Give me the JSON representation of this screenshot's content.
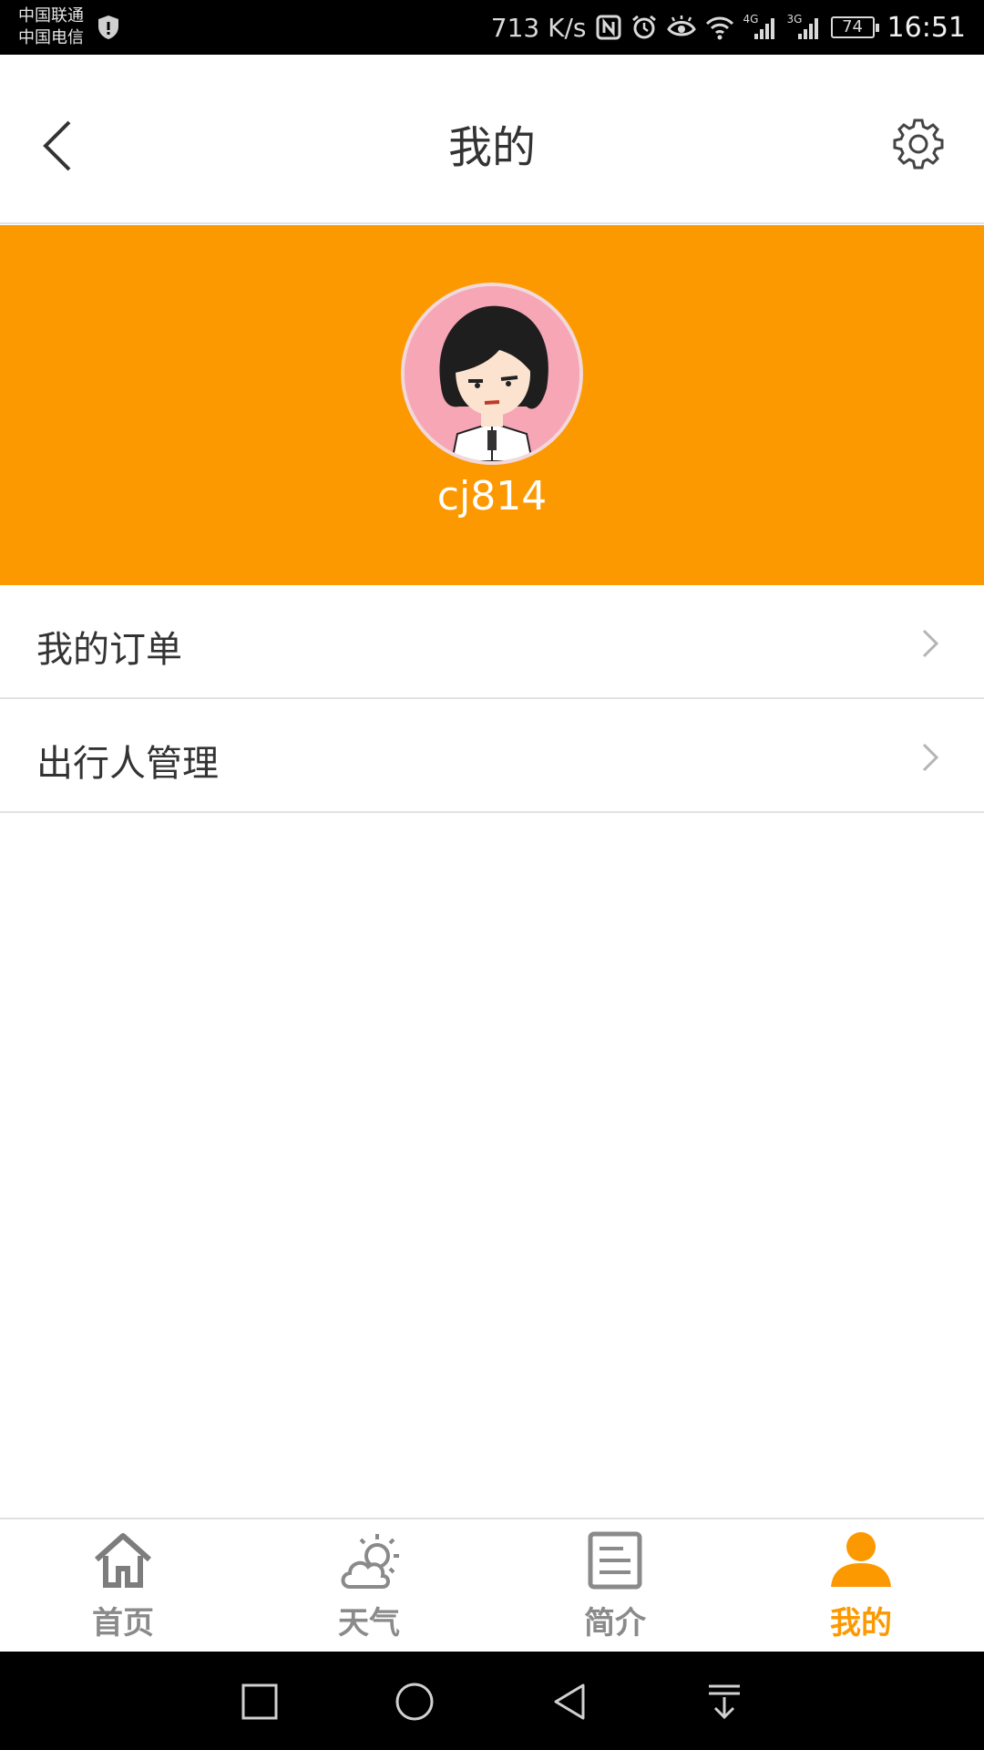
{
  "status_bar": {
    "carrier_1": "中国联通",
    "carrier_2": "中国电信",
    "network_speed": "713 K/s",
    "signal_1_type": "4G",
    "signal_2_type": "3G",
    "battery": "74",
    "time": "16:51"
  },
  "header": {
    "title": "我的",
    "back_icon": "back-arrow-icon",
    "settings_icon": "gear-icon"
  },
  "profile": {
    "username": "cj814",
    "background_color": "#fd9900"
  },
  "menu": {
    "items": [
      {
        "label": "我的订单"
      },
      {
        "label": "出行人管理"
      }
    ]
  },
  "tabs": [
    {
      "label": "首页",
      "icon": "home-icon",
      "active": false
    },
    {
      "label": "天气",
      "icon": "weather-icon",
      "active": false
    },
    {
      "label": "简介",
      "icon": "document-icon",
      "active": false
    },
    {
      "label": "我的",
      "icon": "person-icon",
      "active": true
    }
  ],
  "colors": {
    "accent": "#fd9900",
    "tab_inactive": "#8a8a8a"
  }
}
